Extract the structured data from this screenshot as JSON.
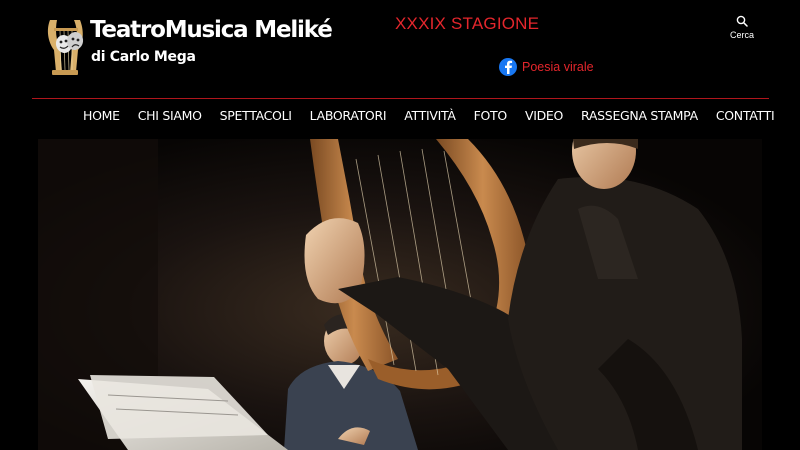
{
  "header": {
    "title": "TeatroMusica Meliké",
    "subtitle": "di Carlo Mega",
    "season": "XXXIX STAGIONE",
    "facebook": {
      "icon": "facebook-icon",
      "label": "Poesia virale"
    },
    "search": {
      "icon": "search-icon",
      "label": "Cerca"
    }
  },
  "nav": {
    "items": [
      {
        "label": "HOME"
      },
      {
        "label": "CHI SIAMO"
      },
      {
        "label": "SPETTACOLI"
      },
      {
        "label": "LABORATORI"
      },
      {
        "label": "ATTIVITÀ"
      },
      {
        "label": "FOTO"
      },
      {
        "label": "VIDEO"
      },
      {
        "label": "RASSEGNA STAMPA"
      },
      {
        "label": "CONTATTI"
      }
    ]
  },
  "colors": {
    "accent_red": "#e3262c",
    "divider": "#b0161c",
    "facebook_blue": "#1877f2",
    "background": "#000000"
  }
}
